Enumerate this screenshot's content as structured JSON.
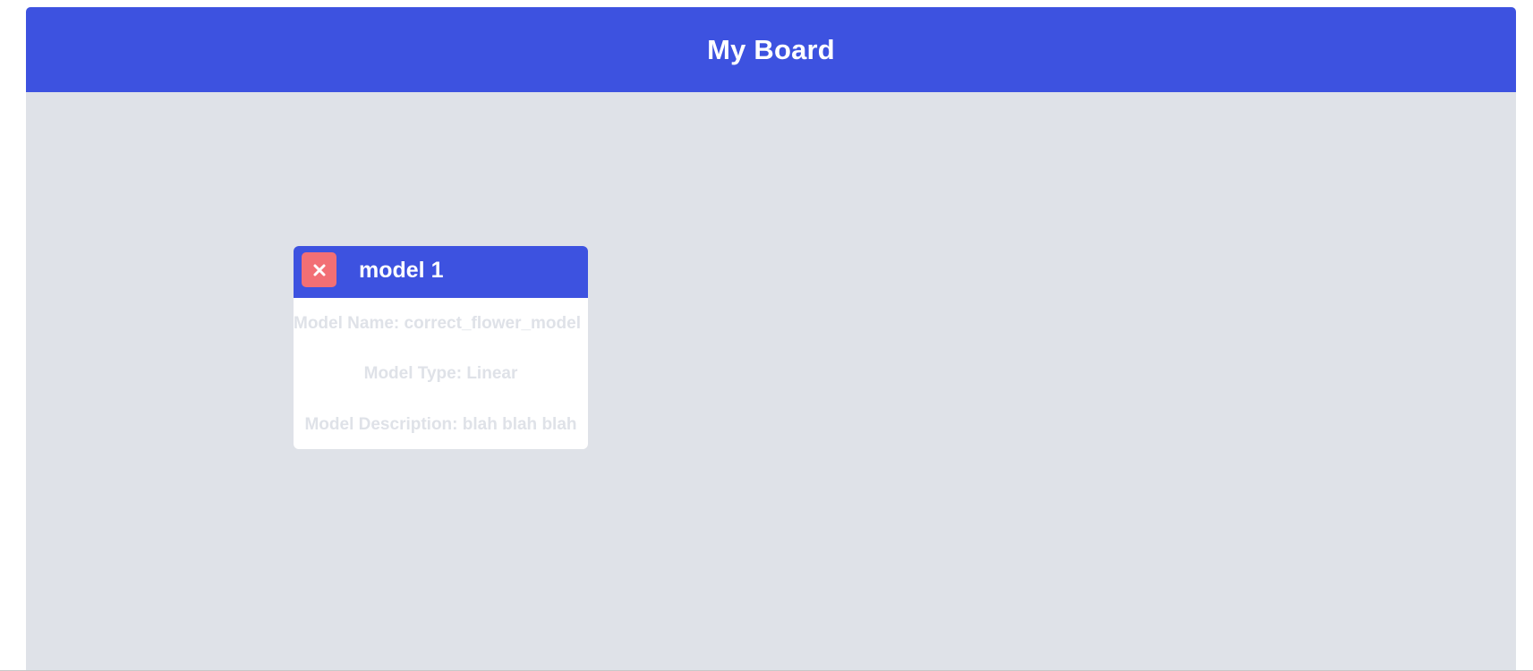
{
  "board": {
    "title": "My Board"
  },
  "card": {
    "title": "model 1",
    "close_icon": "close-icon",
    "lines": {
      "name": "Model Name: correct_flower_model",
      "type": "Model Type: Linear",
      "description": "Model Description: blah blah blah"
    }
  },
  "colors": {
    "header": "#3d52e0",
    "board_background": "#dfe2e8",
    "close_button": "#f26f75",
    "card_background": "#ffffff"
  }
}
